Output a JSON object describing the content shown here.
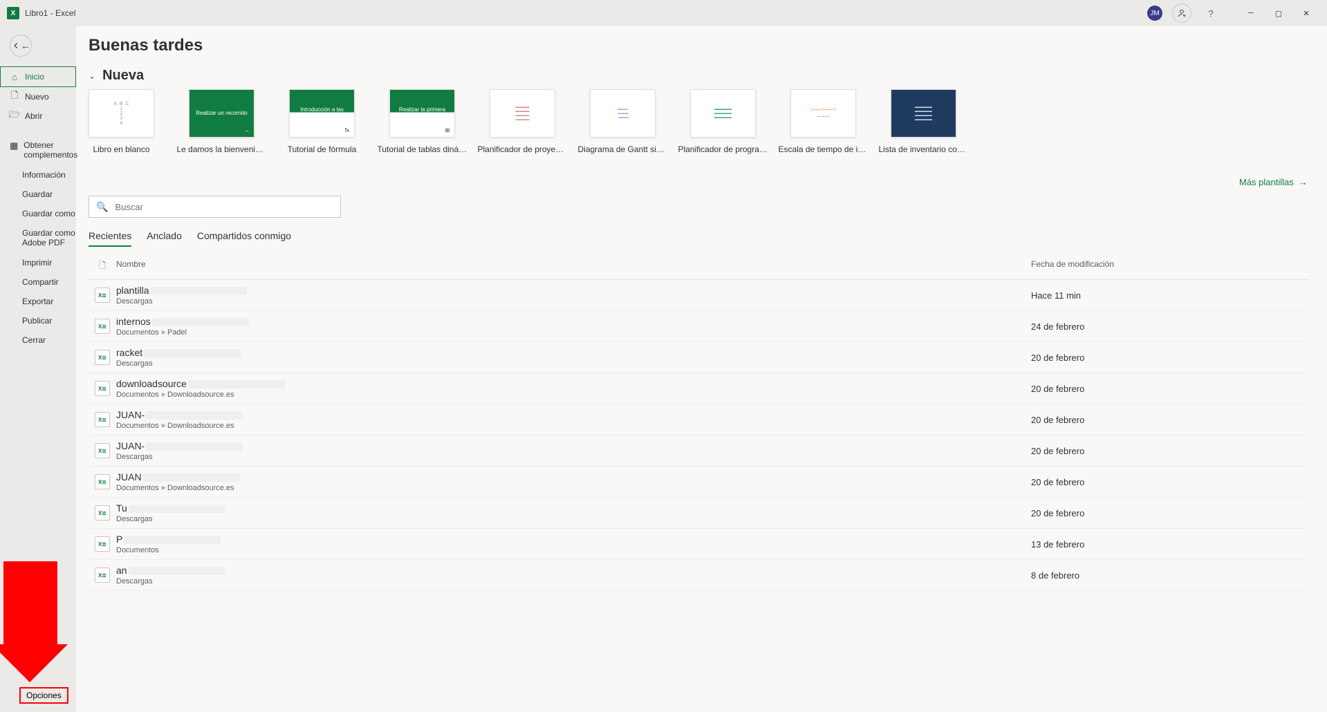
{
  "titlebar": {
    "app_title": "Libro1 - Excel",
    "avatar_initials": "JM",
    "help_tooltip": "?"
  },
  "sidebar": {
    "items": [
      {
        "label": "Inicio"
      },
      {
        "label": "Nuevo"
      },
      {
        "label": "Abrir"
      },
      {
        "label": "Obtener complementos"
      },
      {
        "label": "Información"
      },
      {
        "label": "Guardar"
      },
      {
        "label": "Guardar como"
      },
      {
        "label": "Guardar como Adobe PDF"
      },
      {
        "label": "Imprimir"
      },
      {
        "label": "Compartir"
      },
      {
        "label": "Exportar"
      },
      {
        "label": "Publicar"
      },
      {
        "label": "Cerrar"
      }
    ],
    "options_label": "Opciones"
  },
  "content": {
    "greeting": "Buenas tardes",
    "new_section_label": "Nueva",
    "more_templates_label": "Más plantillas",
    "templates": [
      {
        "label": "Libro en blanco",
        "thumb_text": ""
      },
      {
        "label": "Le damos la bienvenida a Ex...",
        "thumb_text": "Realizar un recorrido"
      },
      {
        "label": "Tutorial de fórmula",
        "thumb_text": "Introducción a las Fórmulas"
      },
      {
        "label": "Tutorial de tablas dinámicas",
        "thumb_text": "Realizar la primera Tabla dinámica"
      },
      {
        "label": "Planificador de proyectos de...",
        "thumb_text": ""
      },
      {
        "label": "Diagrama de Gantt simple",
        "thumb_text": ""
      },
      {
        "label": "Planificador de programació...",
        "thumb_text": ""
      },
      {
        "label": "Escala de tiempo de infograf...",
        "thumb_text": ""
      },
      {
        "label": "Lista de inventario con resalt...",
        "thumb_text": ""
      }
    ],
    "search_placeholder": "Buscar",
    "tabs": [
      {
        "label": "Recientes"
      },
      {
        "label": "Anclado"
      },
      {
        "label": "Compartidos conmigo"
      }
    ],
    "list_header": {
      "name": "Nombre",
      "date": "Fecha de modificación"
    },
    "files": [
      {
        "name": "plantilla",
        "path": "Descargas",
        "date": "Hace 11 min"
      },
      {
        "name": "internos",
        "path": "Documentos » Padel",
        "date": "24 de febrero"
      },
      {
        "name": "racket",
        "path": "Descargas",
        "date": "20 de febrero"
      },
      {
        "name": "downloadsource",
        "path": "Documentos » Downloadsource.es",
        "date": "20 de febrero"
      },
      {
        "name": "JUAN-",
        "path": "Documentos » Downloadsource.es",
        "date": "20 de febrero"
      },
      {
        "name": "JUAN-",
        "path": "Descargas",
        "date": "20 de febrero"
      },
      {
        "name": "JUAN",
        "path": "Documentos » Downloadsource.es",
        "date": "20 de febrero"
      },
      {
        "name": "Tu",
        "path": "Descargas",
        "date": "20 de febrero"
      },
      {
        "name": "P",
        "path": "Documentos",
        "date": "13 de febrero"
      },
      {
        "name": "an",
        "path": "Descargas",
        "date": "8 de febrero"
      }
    ]
  }
}
